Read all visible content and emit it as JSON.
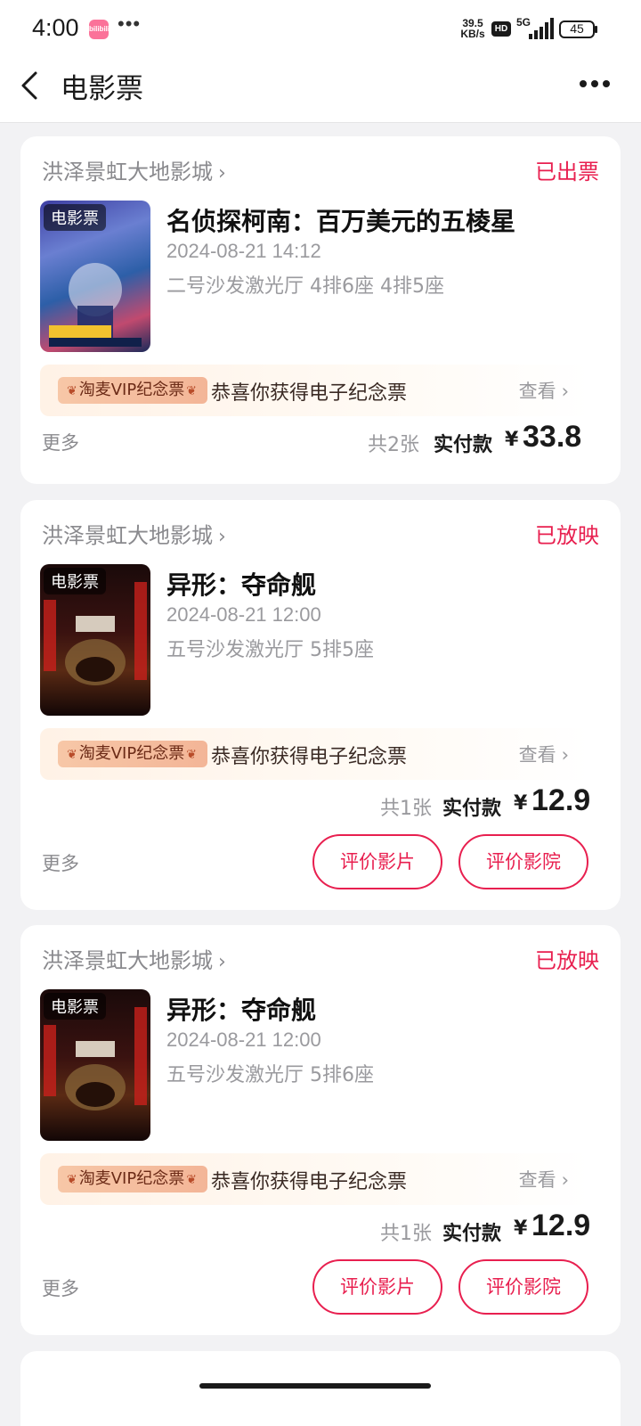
{
  "status_bar": {
    "time": "4:00",
    "app_badge": "bilibili",
    "dots": "•••",
    "speed_top": "39.5",
    "speed_bottom": "KB/s",
    "hd": "HD",
    "network": "5G",
    "battery": "45"
  },
  "header": {
    "title": "电影票",
    "back_icon": "chevron-left-icon",
    "more_icon": "ellipsis-icon"
  },
  "orders": [
    {
      "cinema": "洪泽景虹大地影城",
      "status": "已出票",
      "poster_tag": "电影票",
      "title": "名侦探柯南：百万美元的五棱星",
      "time": "2024-08-21 14:12",
      "seat": "二号沙发激光厅 4排6座 4排5座",
      "vip_badge": "淘麦VIP纪念票",
      "vip_text": "恭喜你获得电子纪念票",
      "vip_view": "查看",
      "more": "更多",
      "count": "共2张",
      "paid_label": "实付款",
      "currency": "¥",
      "amount": "33.8"
    },
    {
      "cinema": "洪泽景虹大地影城",
      "status": "已放映",
      "poster_tag": "电影票",
      "title": "异形：夺命舰",
      "time": "2024-08-21 12:00",
      "seat": "五号沙发激光厅 5排5座",
      "vip_badge": "淘麦VIP纪念票",
      "vip_text": "恭喜你获得电子纪念票",
      "vip_view": "查看",
      "more": "更多",
      "count": "共1张",
      "paid_label": "实付款",
      "currency": "¥",
      "amount": "12.9",
      "btn_film": "评价影片",
      "btn_cinema": "评价影院"
    },
    {
      "cinema": "洪泽景虹大地影城",
      "status": "已放映",
      "poster_tag": "电影票",
      "title": "异形：夺命舰",
      "time": "2024-08-21 12:00",
      "seat": "五号沙发激光厅 5排6座",
      "vip_badge": "淘麦VIP纪念票",
      "vip_text": "恭喜你获得电子纪念票",
      "vip_view": "查看",
      "more": "更多",
      "count": "共1张",
      "paid_label": "实付款",
      "currency": "¥",
      "amount": "12.9",
      "btn_film": "评价影片",
      "btn_cinema": "评价影院"
    }
  ],
  "colors": {
    "accent": "#e81f4f",
    "page_bg": "#f2f2f4",
    "card_bg": "#ffffff"
  }
}
